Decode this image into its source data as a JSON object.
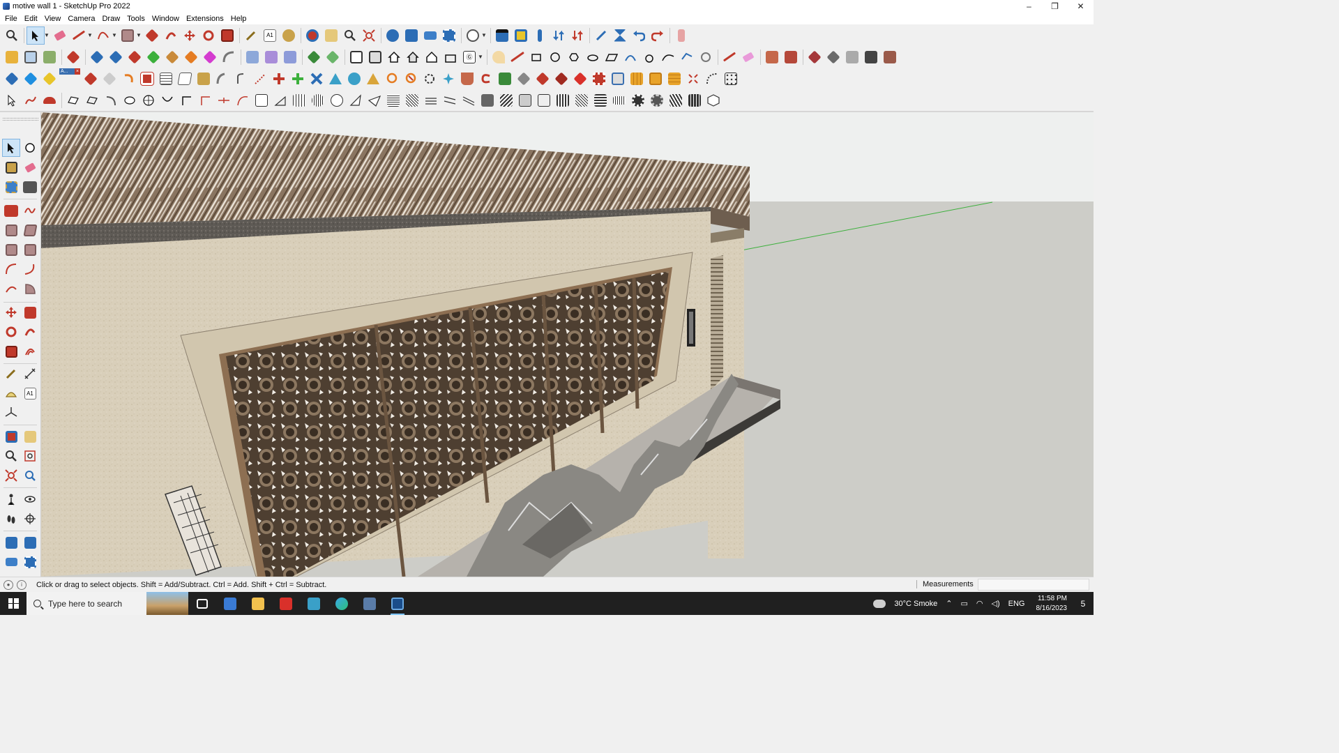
{
  "window": {
    "title": "motive wall 1 - SketchUp Pro 2022",
    "controls": [
      "–",
      "❐",
      "✕"
    ]
  },
  "menu": [
    "File",
    "Edit",
    "View",
    "Camera",
    "Draw",
    "Tools",
    "Window",
    "Extensions",
    "Help"
  ],
  "toolbar_float_label": "A...",
  "status": {
    "hint": "Click or drag to select objects. Shift = Add/Subtract. Ctrl = Add. Shift + Ctrl = Subtract.",
    "measurements_label": "Measurements",
    "measurements_value": ""
  },
  "taskbar": {
    "search_placeholder": "Type here to search",
    "apps": [
      "task-view",
      "calculator",
      "file-explorer",
      "acrobat-reader",
      "sketchup-3",
      "edge",
      "snipping-tool",
      "sketchup-pro"
    ],
    "weather": "30°C  Smoke",
    "language": "ENG",
    "time": "11:58 PM",
    "date": "8/16/2023",
    "notifications": "5"
  },
  "colors": {
    "accent": "#7cc4ff",
    "sky": "#eef0ef",
    "ground": "#cdcdc8",
    "stucco": "#d9cfba",
    "wood_slats": "#8a7561",
    "lattice": "#5a4837",
    "green_axis": "#3cb03c"
  }
}
